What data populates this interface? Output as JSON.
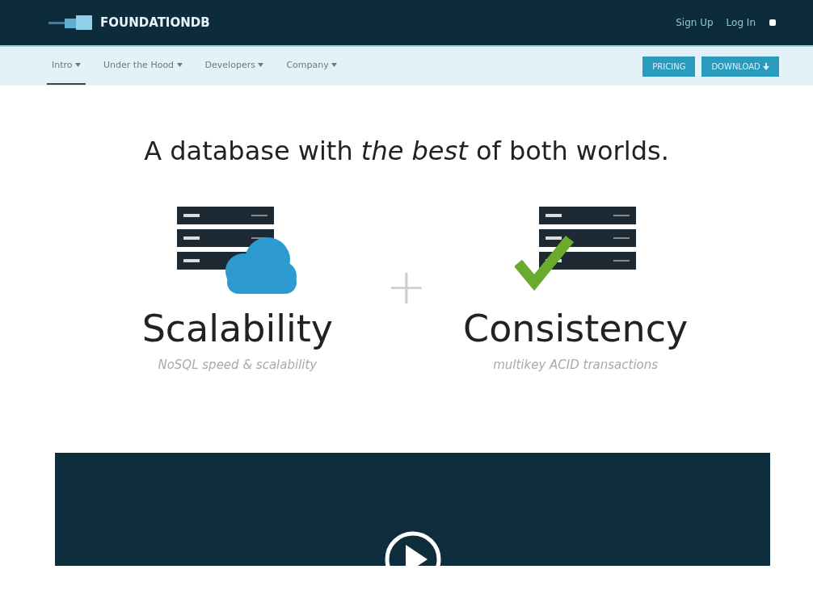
{
  "header": {
    "logo": "FOUNDATIONDB",
    "links": [
      "Sign Up",
      "Log In"
    ]
  },
  "nav": {
    "items": [
      {
        "label": "Intro",
        "selected": true
      },
      {
        "label": "Under the Hood",
        "selected": false
      },
      {
        "label": "Developers",
        "selected": false
      },
      {
        "label": "Company",
        "selected": false
      }
    ],
    "buttons": [
      "PRICING",
      "DOWNLOAD"
    ]
  },
  "hero": {
    "title": "A database with *the best* of both worlds.",
    "plus": "+",
    "features": [
      {
        "kind": "cloud",
        "title": "Scalability",
        "subtitle": "NoSQL speed & scalability"
      },
      {
        "kind": "check",
        "title": "Consistency",
        "subtitle": "multikey ACID transactions"
      }
    ]
  }
}
